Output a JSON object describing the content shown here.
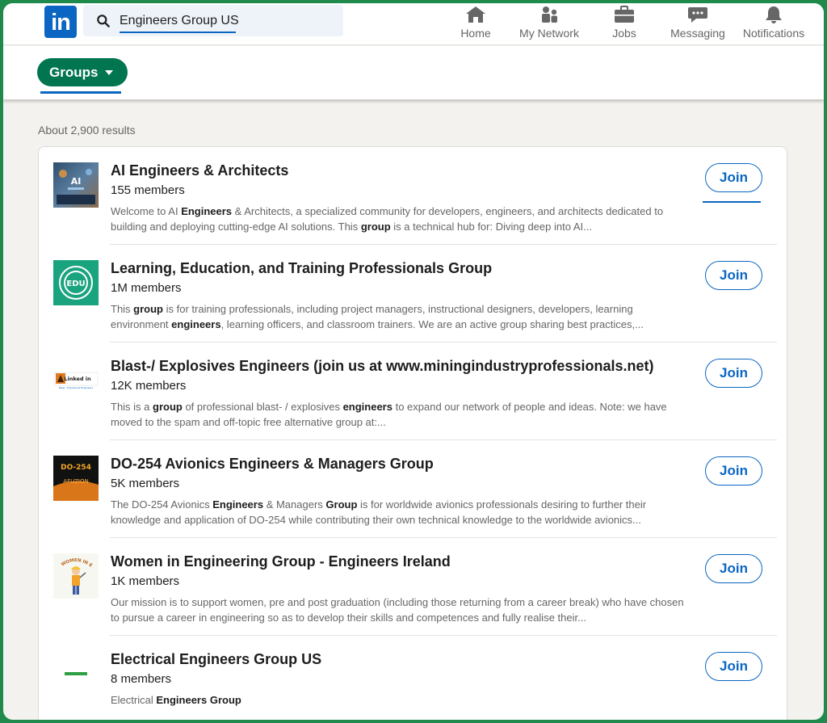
{
  "brand": {
    "logo_text": "in",
    "accent": "#0a66c2",
    "green": "#01754f"
  },
  "search": {
    "value": "Engineers Group US"
  },
  "nav": {
    "items": [
      {
        "label": "Home",
        "icon": "home-icon"
      },
      {
        "label": "My Network",
        "icon": "network-icon"
      },
      {
        "label": "Jobs",
        "icon": "briefcase-icon"
      },
      {
        "label": "Messaging",
        "icon": "chat-icon"
      },
      {
        "label": "Notifications",
        "icon": "bell-icon"
      }
    ]
  },
  "filter": {
    "label": "Groups"
  },
  "results": {
    "count_text": "About 2,900 results",
    "join_label": "Join",
    "items": [
      {
        "title": "AI Engineers & Architects",
        "members": "155 members",
        "desc_parts": [
          "Welcome to AI ",
          "Engineers",
          " & Architects, a specialized community for developers, engineers, and architects dedicated to building and deploying cutting-edge AI solutions. This ",
          "group",
          " is a technical hub for: Diving deep into AI..."
        ],
        "thumb": "ai-thumb"
      },
      {
        "title": "Learning, Education, and Training Professionals Group",
        "members": "1M members",
        "desc_parts": [
          "This ",
          "group",
          " is for training professionals, including project managers, instructional designers, developers, learning environment ",
          "engineers",
          ", learning officers, and classroom trainers. We are an active group sharing best practices,..."
        ],
        "thumb": "edu-thumb",
        "thumb_text": "EDU"
      },
      {
        "title": "Blast-/ Explosives Engineers (join us at www.miningindustryprofessionals.net)",
        "members": "12K members",
        "desc_parts": [
          "This is a ",
          "group",
          " of professional blast- / explosives ",
          "engineers",
          " to expand our network of people and ideas. Note: we have moved to the spam and off-topic free alternative group at:..."
        ],
        "thumb": "blast-thumb",
        "thumb_text": "Linked in",
        "thumb_sub": "Blast - Explosives Engineers"
      },
      {
        "title": "DO-254 Avionics Engineers & Managers Group",
        "members": "5K members",
        "desc_parts": [
          "The DO-254 Avionics ",
          "Engineers",
          " & Managers ",
          "Group",
          " is for worldwide avionics professionals desiring to further their knowledge and application of DO-254 while contributing their own technical knowledge to the worldwide avionics..."
        ],
        "thumb": "do254-thumb",
        "thumb_text": "DO-254",
        "thumb_sub": "AFUZION"
      },
      {
        "title": "Women in Engineering Group - Engineers Ireland",
        "members": "1K members",
        "desc_parts": [
          "Our mission is to support women, pre and post graduation (including those returning from a career break) who have chosen to pursue a career in engineering so as to develop their skills and competences and fully realise their..."
        ],
        "thumb": "wie-thumb",
        "thumb_text": "WOMEN IN ENG"
      },
      {
        "title": "Electrical Engineers Group US",
        "members": "8 members",
        "desc_parts": [
          "Electrical ",
          "Engineers Group"
        ],
        "thumb": "electrical-thumb"
      }
    ]
  }
}
